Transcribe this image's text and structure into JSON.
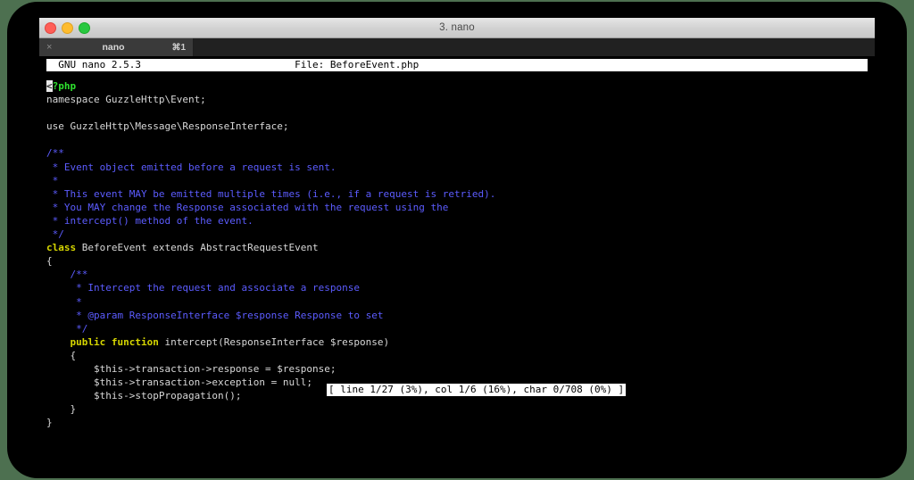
{
  "window": {
    "title": "3. nano",
    "traffic_lights": [
      {
        "name": "close",
        "color": "#ff5f57"
      },
      {
        "name": "minimize",
        "color": "#febc2e"
      },
      {
        "name": "zoom",
        "color": "#28c840"
      }
    ]
  },
  "tabbar": {
    "tabs": [
      {
        "close_icon": "×",
        "label": "nano",
        "shortcut": "⌘1"
      }
    ]
  },
  "nano": {
    "header": "  GNU nano 2.5.3                          File: BeforeEvent.php",
    "status": "[ line 1/27 (3%), col 1/6 (16%), char 0/708 (0%) ]",
    "cursor_char": "<",
    "lines": [
      {
        "segments": [
          {
            "t": "<",
            "c": "cursor"
          },
          {
            "t": "?php",
            "c": "c-php"
          }
        ]
      },
      {
        "segments": [
          {
            "t": "namespace GuzzleHttp\\Event;",
            "c": "c-plain"
          }
        ]
      },
      {
        "segments": [
          {
            "t": "",
            "c": "c-plain"
          }
        ]
      },
      {
        "segments": [
          {
            "t": "use GuzzleHttp\\Message\\ResponseInterface;",
            "c": "c-plain"
          }
        ]
      },
      {
        "segments": [
          {
            "t": "",
            "c": "c-plain"
          }
        ]
      },
      {
        "segments": [
          {
            "t": "/**",
            "c": "c-comment"
          }
        ]
      },
      {
        "segments": [
          {
            "t": " * Event object emitted before a request is sent.",
            "c": "c-comment"
          }
        ]
      },
      {
        "segments": [
          {
            "t": " *",
            "c": "c-comment"
          }
        ]
      },
      {
        "segments": [
          {
            "t": " * This event MAY be emitted multiple times (i.e., if a request is retried).",
            "c": "c-comment"
          }
        ]
      },
      {
        "segments": [
          {
            "t": " * You MAY change the Response associated with the request using the",
            "c": "c-comment"
          }
        ]
      },
      {
        "segments": [
          {
            "t": " * intercept() method of the event.",
            "c": "c-comment"
          }
        ]
      },
      {
        "segments": [
          {
            "t": " */",
            "c": "c-comment"
          }
        ]
      },
      {
        "segments": [
          {
            "t": "class",
            "c": "c-keyword"
          },
          {
            "t": " BeforeEvent extends AbstractRequestEvent",
            "c": "c-plain"
          }
        ]
      },
      {
        "segments": [
          {
            "t": "{",
            "c": "c-plain"
          }
        ]
      },
      {
        "segments": [
          {
            "t": "    /**",
            "c": "c-comment"
          }
        ]
      },
      {
        "segments": [
          {
            "t": "     * Intercept the request and associate a response",
            "c": "c-comment"
          }
        ]
      },
      {
        "segments": [
          {
            "t": "     *",
            "c": "c-comment"
          }
        ]
      },
      {
        "segments": [
          {
            "t": "     * @param ResponseInterface $response Response to set",
            "c": "c-comment"
          }
        ]
      },
      {
        "segments": [
          {
            "t": "     */",
            "c": "c-comment"
          }
        ]
      },
      {
        "segments": [
          {
            "t": "    public function",
            "c": "c-keyword"
          },
          {
            "t": " intercept(ResponseInterface $response)",
            "c": "c-plain"
          }
        ]
      },
      {
        "segments": [
          {
            "t": "    {",
            "c": "c-plain"
          }
        ]
      },
      {
        "segments": [
          {
            "t": "        $this->transaction->response = $response;",
            "c": "c-plain"
          }
        ]
      },
      {
        "segments": [
          {
            "t": "        $this->transaction->exception = null;",
            "c": "c-plain"
          }
        ]
      },
      {
        "segments": [
          {
            "t": "        $this->stopPropagation();",
            "c": "c-plain"
          }
        ]
      },
      {
        "segments": [
          {
            "t": "    }",
            "c": "c-plain"
          }
        ]
      },
      {
        "segments": [
          {
            "t": "}",
            "c": "c-plain"
          }
        ]
      }
    ]
  },
  "colors": {
    "page_background": "#4d7050",
    "terminal_background": "#000000",
    "comment": "#5c5cff",
    "keyword": "#d7d700",
    "php_tag": "#2ee02e",
    "text": "#d8d8d8"
  }
}
